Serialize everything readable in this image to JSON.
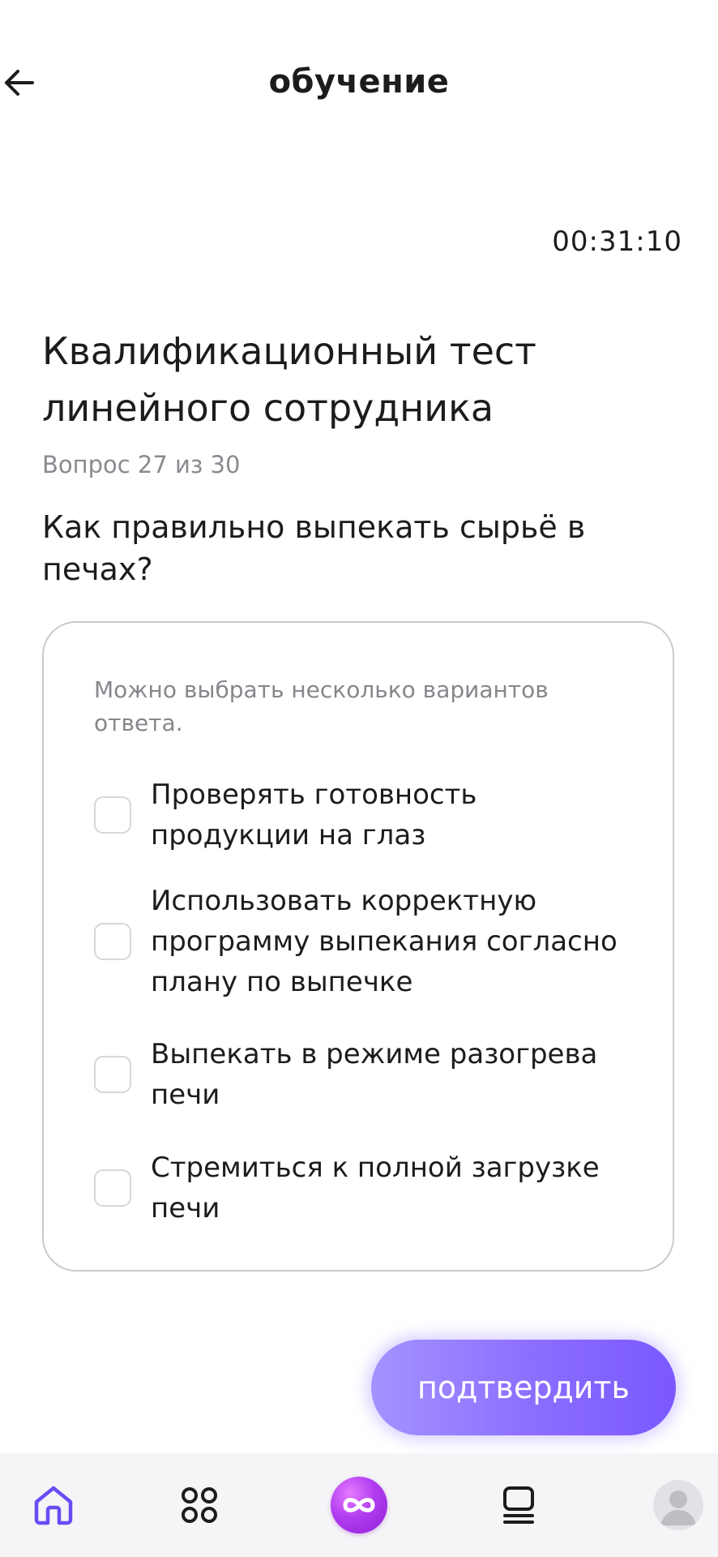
{
  "header": {
    "title": "обучение"
  },
  "timer": "00:31:10",
  "test": {
    "title": "Квалификационный тест линейного сотрудника",
    "progress": "Вопрос 27 из 30",
    "question": "Как правильно выпекать сырьё в печах?"
  },
  "answers": {
    "hint": "Можно выбрать несколько вариантов ответа.",
    "options": [
      {
        "label": "Проверять готовность продукции на глаз",
        "checked": false
      },
      {
        "label": "Использовать корректную программу выпекания согласно плану по выпечке",
        "checked": false
      },
      {
        "label": "Выпекать в режиме разогрева печи",
        "checked": false
      },
      {
        "label": "Стремиться к полной загрузке печи",
        "checked": false
      }
    ]
  },
  "confirm_label": "подтвердить",
  "tabbar": {
    "items": [
      {
        "icon": "home-icon",
        "active": true
      },
      {
        "icon": "apps-grid-icon",
        "active": false
      },
      {
        "icon": "infinity-icon",
        "active": false
      },
      {
        "icon": "courses-icon",
        "active": false
      },
      {
        "icon": "avatar-icon",
        "active": false
      }
    ]
  },
  "colors": {
    "accent": "#8b6dff",
    "home_active": "#6a4cf5",
    "center_tab": "#b23df0",
    "muted_text": "#8a8a90"
  }
}
